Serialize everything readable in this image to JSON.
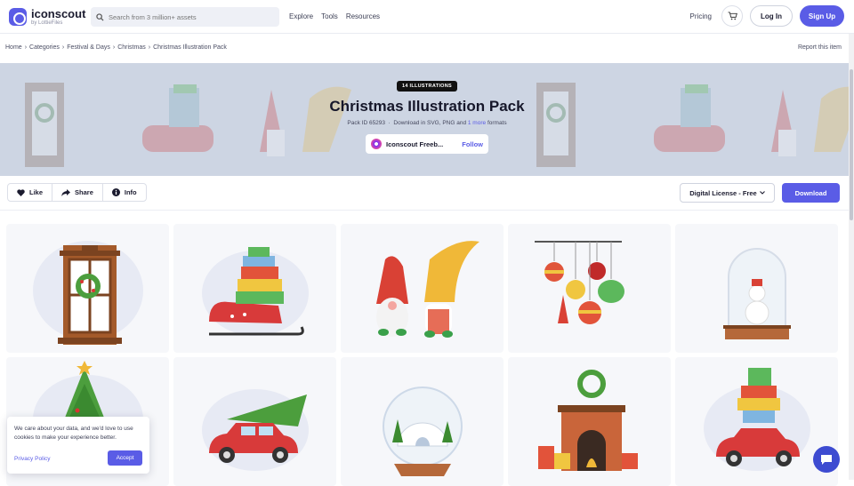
{
  "header": {
    "logo_name": "iconscout",
    "logo_sub": "by LottieFiles",
    "search_placeholder": "Search from 3 million+ assets",
    "nav": [
      "Explore",
      "Tools",
      "Resources"
    ],
    "pricing": "Pricing",
    "login": "Log In",
    "signup": "Sign Up"
  },
  "breadcrumb": [
    "Home",
    "Categories",
    "Festival & Days",
    "Christmas",
    "Christmas Illustration Pack"
  ],
  "report": "Report this item",
  "hero": {
    "badge": "14 ILLUSTRATIONS",
    "title": "Christmas Illustration Pack",
    "pack_id": "Pack ID 65293",
    "download_text": "Download in SVG, PNG and",
    "more_link": "1 more",
    "formats": "formats",
    "author": "Iconscout Freeb...",
    "follow": "Follow"
  },
  "actions": {
    "like": "Like",
    "share": "Share",
    "info": "Info",
    "license": "Digital License - Free",
    "download": "Download"
  },
  "illustrations": [
    {
      "icon": "door-wreath"
    },
    {
      "icon": "sleigh-gifts"
    },
    {
      "icon": "gnomes"
    },
    {
      "icon": "ornaments"
    },
    {
      "icon": "snow-globe-snowman"
    },
    {
      "icon": "christmas-tree"
    },
    {
      "icon": "car-tree"
    },
    {
      "icon": "igloo-globe"
    },
    {
      "icon": "fireplace"
    },
    {
      "icon": "car-gifts"
    }
  ],
  "cookie": {
    "text": "We care about your data, and we'd love to use cookies to make your experience better.",
    "link": "Privacy Policy",
    "accept": "Accept"
  },
  "colors": {
    "accent": "#5a5ce6",
    "hero_bg": "#cdd5e3"
  }
}
